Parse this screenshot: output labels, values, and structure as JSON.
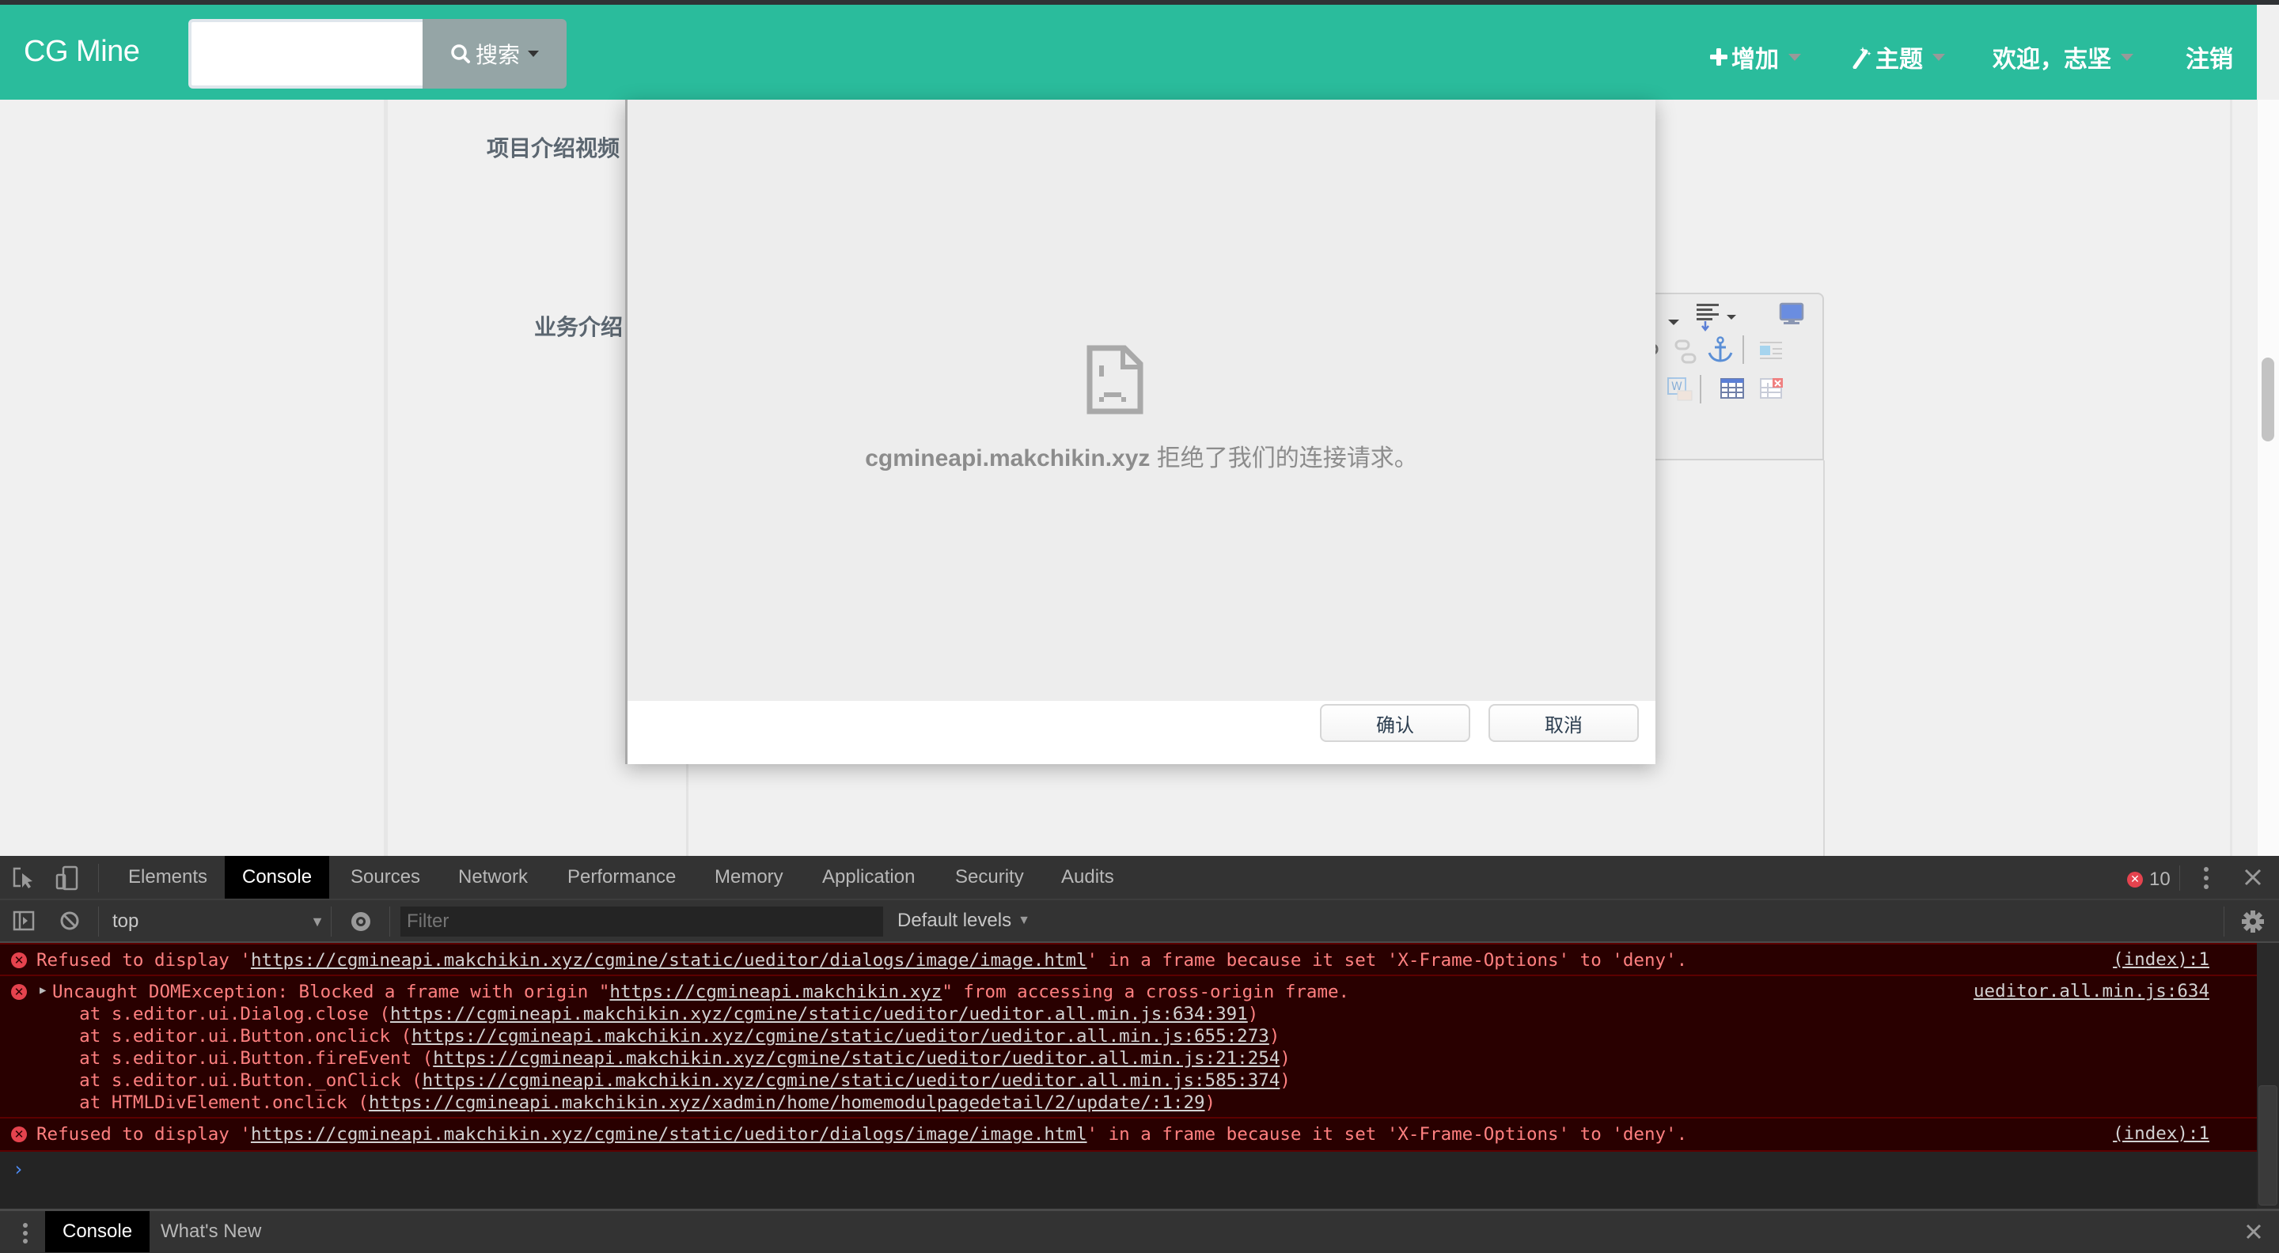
{
  "navbar": {
    "brand": "CG Mine",
    "search_value": "",
    "search_button": "搜索",
    "add_label": "增加",
    "theme_label": "主题",
    "user_label": "欢迎，志坚",
    "logout_label": "注销",
    "accent_color": "#2abc9c"
  },
  "form": {
    "label_video": "项目介绍视频",
    "label_business": "业务介绍"
  },
  "dialog": {
    "error_host": "cgmineapi.makchikin.xyz",
    "error_text": " 拒绝了我们的连接请求。",
    "confirm_label": "确认",
    "cancel_label": "取消"
  },
  "devtools": {
    "tabs": [
      "Elements",
      "Console",
      "Sources",
      "Network",
      "Performance",
      "Memory",
      "Application",
      "Security",
      "Audits"
    ],
    "active_tab": "Console",
    "error_count": "10",
    "context": "top",
    "filter_placeholder": "Filter",
    "levels": "Default levels",
    "messages": [
      {
        "prefix": "Refused to display '",
        "url": "https://cgmineapi.makchikin.xyz/cgmine/static/ueditor/dialogs/image/image.html",
        "suffix": "' in a frame because it set 'X-Frame-Options' to 'deny'.",
        "source": "(index):1"
      },
      {
        "prefix": "Uncaught DOMException: Blocked a frame with origin \"",
        "url": "https://cgmineapi.makchikin.xyz",
        "suffix": "\" from accessing a cross-origin frame.",
        "source": "ueditor.all.min.js:634",
        "stack": [
          {
            "at": "    at s.editor.ui.Dialog.close (",
            "url": "https://cgmineapi.makchikin.xyz/cgmine/static/ueditor/ueditor.all.min.js:634:391",
            "end": ")"
          },
          {
            "at": "    at s.editor.ui.Button.onclick (",
            "url": "https://cgmineapi.makchikin.xyz/cgmine/static/ueditor/ueditor.all.min.js:655:273",
            "end": ")"
          },
          {
            "at": "    at s.editor.ui.Button.fireEvent (",
            "url": "https://cgmineapi.makchikin.xyz/cgmine/static/ueditor/ueditor.all.min.js:21:254",
            "end": ")"
          },
          {
            "at": "    at s.editor.ui.Button._onClick (",
            "url": "https://cgmineapi.makchikin.xyz/cgmine/static/ueditor/ueditor.all.min.js:585:374",
            "end": ")"
          },
          {
            "at": "    at HTMLDivElement.onclick (",
            "url": "https://cgmineapi.makchikin.xyz/xadmin/home/homemodulpagedetail/2/update/:1:29",
            "end": ")"
          }
        ]
      },
      {
        "prefix": "Refused to display '",
        "url": "https://cgmineapi.makchikin.xyz/cgmine/static/ueditor/dialogs/image/image.html",
        "suffix": "' in a frame because it set 'X-Frame-Options' to 'deny'.",
        "source": "(index):1"
      }
    ],
    "drawer_tabs": [
      "Console",
      "What's New"
    ],
    "drawer_active": "Console",
    "error_color": "#ff8080"
  }
}
